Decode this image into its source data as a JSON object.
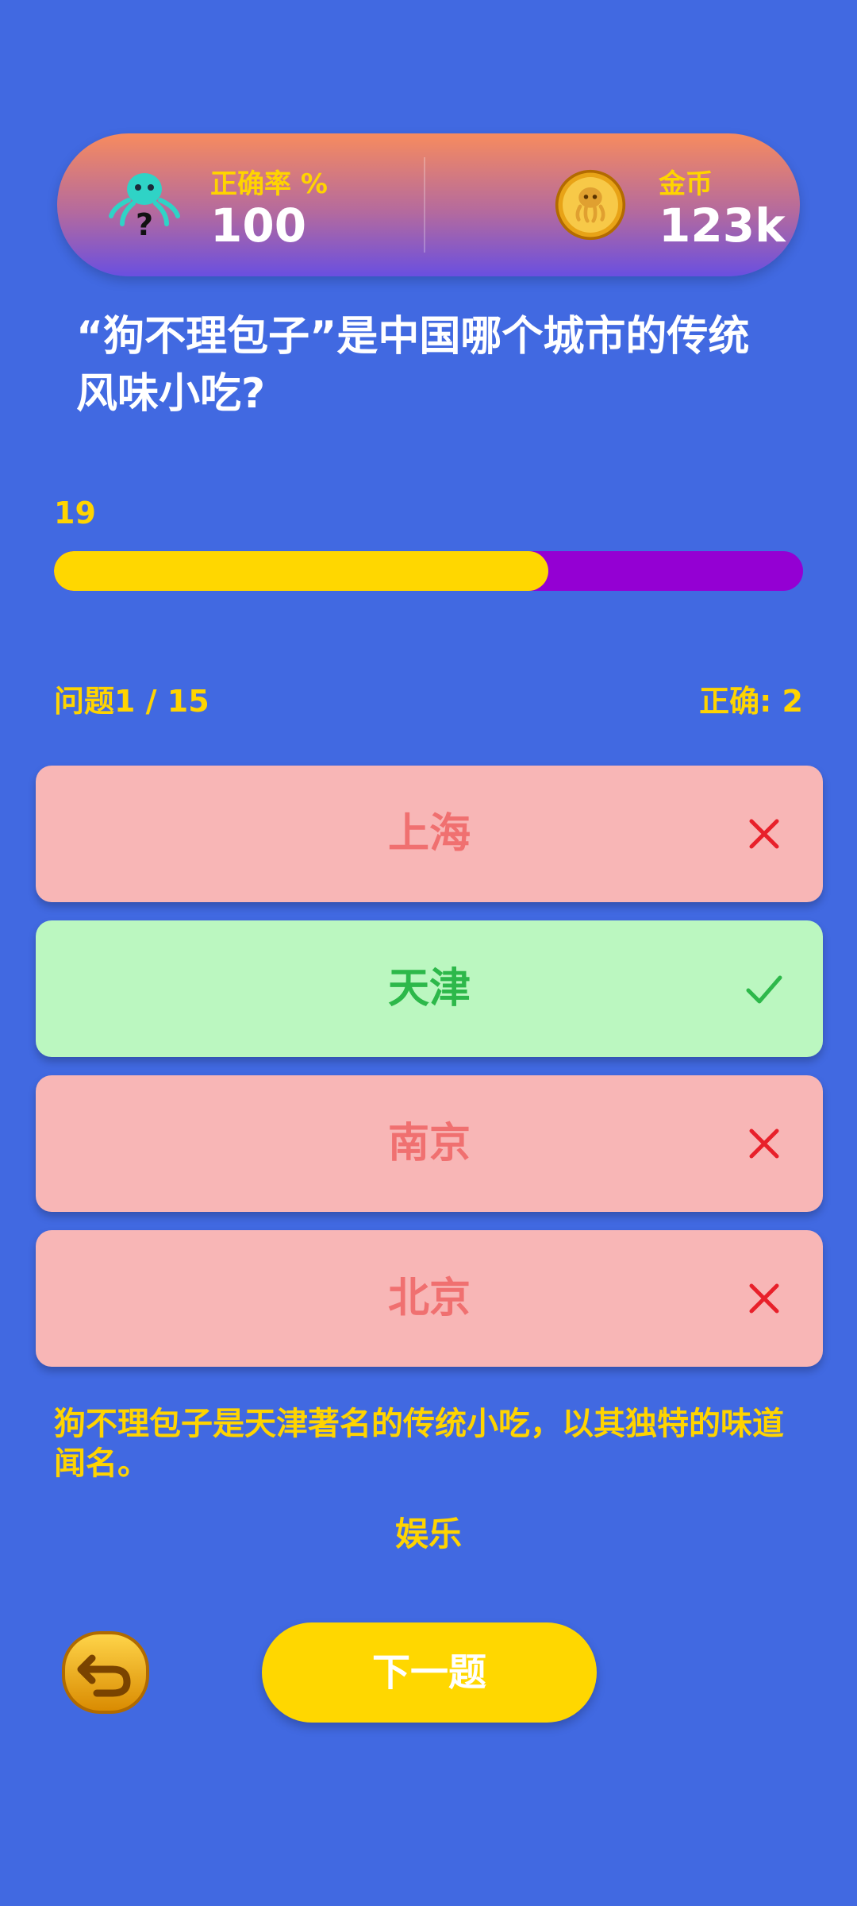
{
  "stats": {
    "accuracy_label": "正确率 %",
    "accuracy_value": "100",
    "coins_label": "金币",
    "coins_value": "123k",
    "accuracy_icon": "octopus-question-icon",
    "coins_icon": "octopus-coin-icon"
  },
  "question": {
    "text": "“狗不理包子”是中国哪个城市的传统风味小吃?"
  },
  "timer": {
    "seconds": "19",
    "fill_fraction": 0.66
  },
  "progress": {
    "question_label": "问题1 / 15",
    "correct_label": "正确: 2"
  },
  "answers": [
    {
      "label": "上海",
      "state": "wrong",
      "icon": "cross-icon"
    },
    {
      "label": "天津",
      "state": "right",
      "icon": "check-icon"
    },
    {
      "label": "南京",
      "state": "wrong",
      "icon": "cross-icon"
    },
    {
      "label": "北京",
      "state": "wrong",
      "icon": "cross-icon"
    }
  ],
  "explanation": "狗不理包子是天津著名的传统小吃，以其独特的味道闻名。",
  "category": "娱乐",
  "buttons": {
    "back_icon": "back-arrow-icon",
    "next_label": "下一题"
  },
  "colors": {
    "background": "#4169E1",
    "accent_yellow": "#FFD700",
    "timer_track": "#9400D3",
    "wrong_bg": "#F8B6B6",
    "right_bg": "#BBF7C0",
    "wrong_mark": "#E8202A",
    "right_mark": "#2DB84A"
  }
}
